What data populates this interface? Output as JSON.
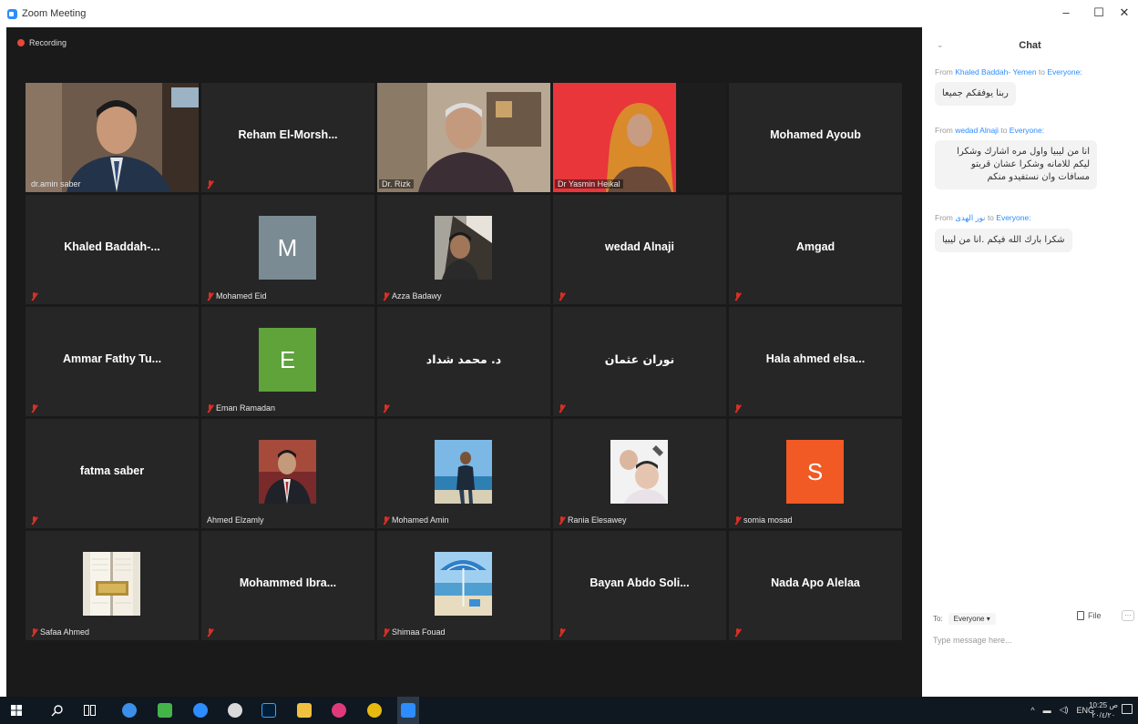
{
  "window": {
    "title": "Zoom Meeting",
    "min": "–",
    "max": "☐",
    "close": "✕"
  },
  "recording": "Recording",
  "tiles": [
    {
      "id": "amin",
      "label": "dr.amin saber",
      "kind": "video",
      "muted": false
    },
    {
      "id": "reham",
      "big": "Reham  El-Morsh...",
      "kind": "name",
      "muted": true
    },
    {
      "id": "rizk",
      "label": "Dr. Rizk",
      "kind": "video",
      "muted": false
    },
    {
      "id": "yasmin",
      "label": "Dr Yasmin Heikal",
      "kind": "video",
      "muted": false,
      "active": true
    },
    {
      "id": "ayoub",
      "big": "Mohamed Ayoub",
      "kind": "name",
      "muted": false
    },
    {
      "id": "khaled",
      "big": "Khaled  Baddah-...",
      "kind": "name",
      "muted": true
    },
    {
      "id": "eid",
      "label": "Mohamed Eid",
      "kind": "avatar",
      "letter": "M",
      "color": "#7b8b93",
      "muted": true
    },
    {
      "id": "azza",
      "label": "Azza Badawy",
      "kind": "photo",
      "muted": true
    },
    {
      "id": "wedad",
      "big": "wedad Alnaji",
      "kind": "name",
      "muted": true
    },
    {
      "id": "amgad",
      "big": "Amgad",
      "kind": "name",
      "muted": true
    },
    {
      "id": "ammar",
      "big": "Ammar Fathy Tu...",
      "kind": "name",
      "muted": true
    },
    {
      "id": "eman",
      "label": "Eman Ramadan",
      "kind": "avatar",
      "letter": "E",
      "color": "#5fa33a",
      "muted": true
    },
    {
      "id": "mshaddad",
      "big": "د. محمد شداد",
      "kind": "name",
      "muted": true
    },
    {
      "id": "nouran",
      "big": "نوران عثمان",
      "kind": "name",
      "muted": true
    },
    {
      "id": "hala",
      "big": "Hala ahmed elsa...",
      "kind": "name",
      "muted": true
    },
    {
      "id": "fatma",
      "big": "fatma saber",
      "kind": "name",
      "muted": true
    },
    {
      "id": "elzamly",
      "label": "Ahmed Elzamly",
      "kind": "photo",
      "muted": false
    },
    {
      "id": "amin2",
      "label": "Mohamed Amin",
      "kind": "photo",
      "muted": true
    },
    {
      "id": "rania",
      "label": "Rania Elesawey",
      "kind": "photo",
      "muted": true
    },
    {
      "id": "somia",
      "label": "somia mosad",
      "kind": "avatar",
      "letter": "S",
      "color": "#f15a24",
      "muted": true
    },
    {
      "id": "safaa",
      "label": "Safaa Ahmed",
      "kind": "photo",
      "muted": true
    },
    {
      "id": "ibra",
      "big": "Mohammed  Ibra...",
      "kind": "name",
      "muted": true
    },
    {
      "id": "shimaa",
      "label": "Shimaa Fouad",
      "kind": "photo",
      "muted": true
    },
    {
      "id": "bayan",
      "big": "Bayan  Abdo  Soli...",
      "kind": "name",
      "muted": true
    },
    {
      "id": "nada",
      "big": "Nada Apo Alelaa",
      "kind": "name",
      "muted": true
    }
  ],
  "chat": {
    "title": "Chat",
    "messages": [
      {
        "from_prefix": "From",
        "from": "Khaled Baddah- Yemen",
        "to_word": "to",
        "to": "Everyone:",
        "text": "ربنا يوفقكم جميعا"
      },
      {
        "from_prefix": "From",
        "from": "wedad Alnaji",
        "to_word": "to",
        "to": "Everyone:",
        "text": "انا من ليبيا واول مره اشارك وشكرا ليكم للامانه وشكرا عشان قربتو مسافات وان نستفيدو منكم"
      },
      {
        "from_prefix": "From",
        "from": "نور الهدى",
        "to_word": "to",
        "to": "Everyone:",
        "text": "شكرا بارك الله فيكم .انا من ليبيا"
      }
    ],
    "to_label": "To:",
    "to_value": "Everyone ▾",
    "file_label": "File",
    "more_label": "···",
    "input_placeholder": "Type message here..."
  },
  "taskbar": {
    "lang": "ENG",
    "time": "10:25 ص",
    "date": "٢٠/٤/٢٠"
  }
}
